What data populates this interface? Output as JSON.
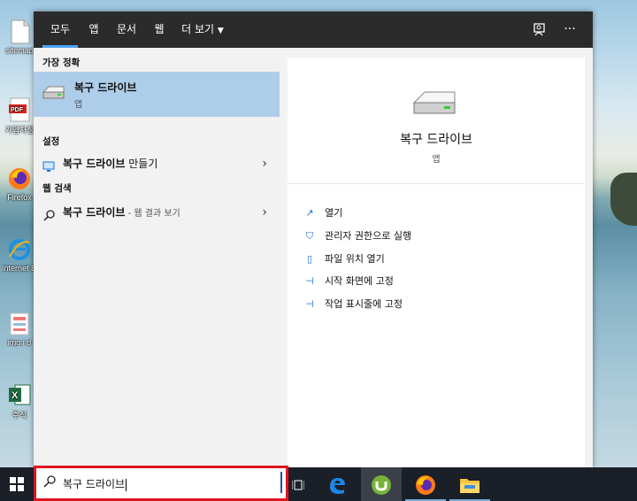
{
  "colors": {
    "accent": "#4aa3f5",
    "highlight": "#aecde9",
    "taskbar": "#1a1f28",
    "searchbox_border": "#e0141e"
  },
  "desktop": {
    "icons": [
      {
        "label": "sitemap",
        "icon": "file-icon"
      },
      {
        "label": "가입자정",
        "icon": "pdf-icon"
      },
      {
        "label": "Firefox",
        "icon": "firefox-icon"
      },
      {
        "label": "Internet Explorer",
        "icon": "ie-icon"
      },
      {
        "label": "img i d",
        "icon": "image-file-icon"
      },
      {
        "label": "주식",
        "icon": "excel-icon"
      }
    ]
  },
  "search": {
    "tabs": [
      {
        "label": "모두",
        "active": true
      },
      {
        "label": "앱"
      },
      {
        "label": "문서"
      },
      {
        "label": "웹"
      },
      {
        "label": "더 보기",
        "has_dropdown": true
      }
    ],
    "icons": {
      "feedback": "feedback-icon",
      "more": "more-icon"
    },
    "sections": {
      "best_match": "가장 정확",
      "settings": "설정",
      "web": "웹 검색"
    },
    "best_match": {
      "title": "복구 드라이브",
      "type": "앱"
    },
    "settings_item": {
      "label_bold": "복구 드라이브",
      "label_rest": " 만들기"
    },
    "web_item": {
      "label_bold": "복구 드라이브",
      "label_rest": " - 웹 결과 보기"
    },
    "detail": {
      "title": "복구 드라이브",
      "type": "앱",
      "actions": [
        {
          "label": "열기",
          "icon": "open-icon"
        },
        {
          "label": "관리자 권한으로 실행",
          "icon": "shield-icon"
        },
        {
          "label": "파일 위치 열기",
          "icon": "file-location-icon"
        },
        {
          "label": "시작 화면에 고정",
          "icon": "pin-icon"
        },
        {
          "label": "작업 표시줄에 고정",
          "icon": "pin-icon"
        }
      ]
    },
    "query": "복구 드라이브"
  },
  "taskbar": {
    "apps": [
      {
        "name": "task-view",
        "icon": "task-view-icon"
      },
      {
        "name": "edge",
        "icon": "edge-icon"
      },
      {
        "name": "utorrent",
        "icon": "utorrent-icon"
      },
      {
        "name": "firefox",
        "icon": "firefox-icon"
      },
      {
        "name": "file-explorer",
        "icon": "folder-icon"
      }
    ]
  }
}
